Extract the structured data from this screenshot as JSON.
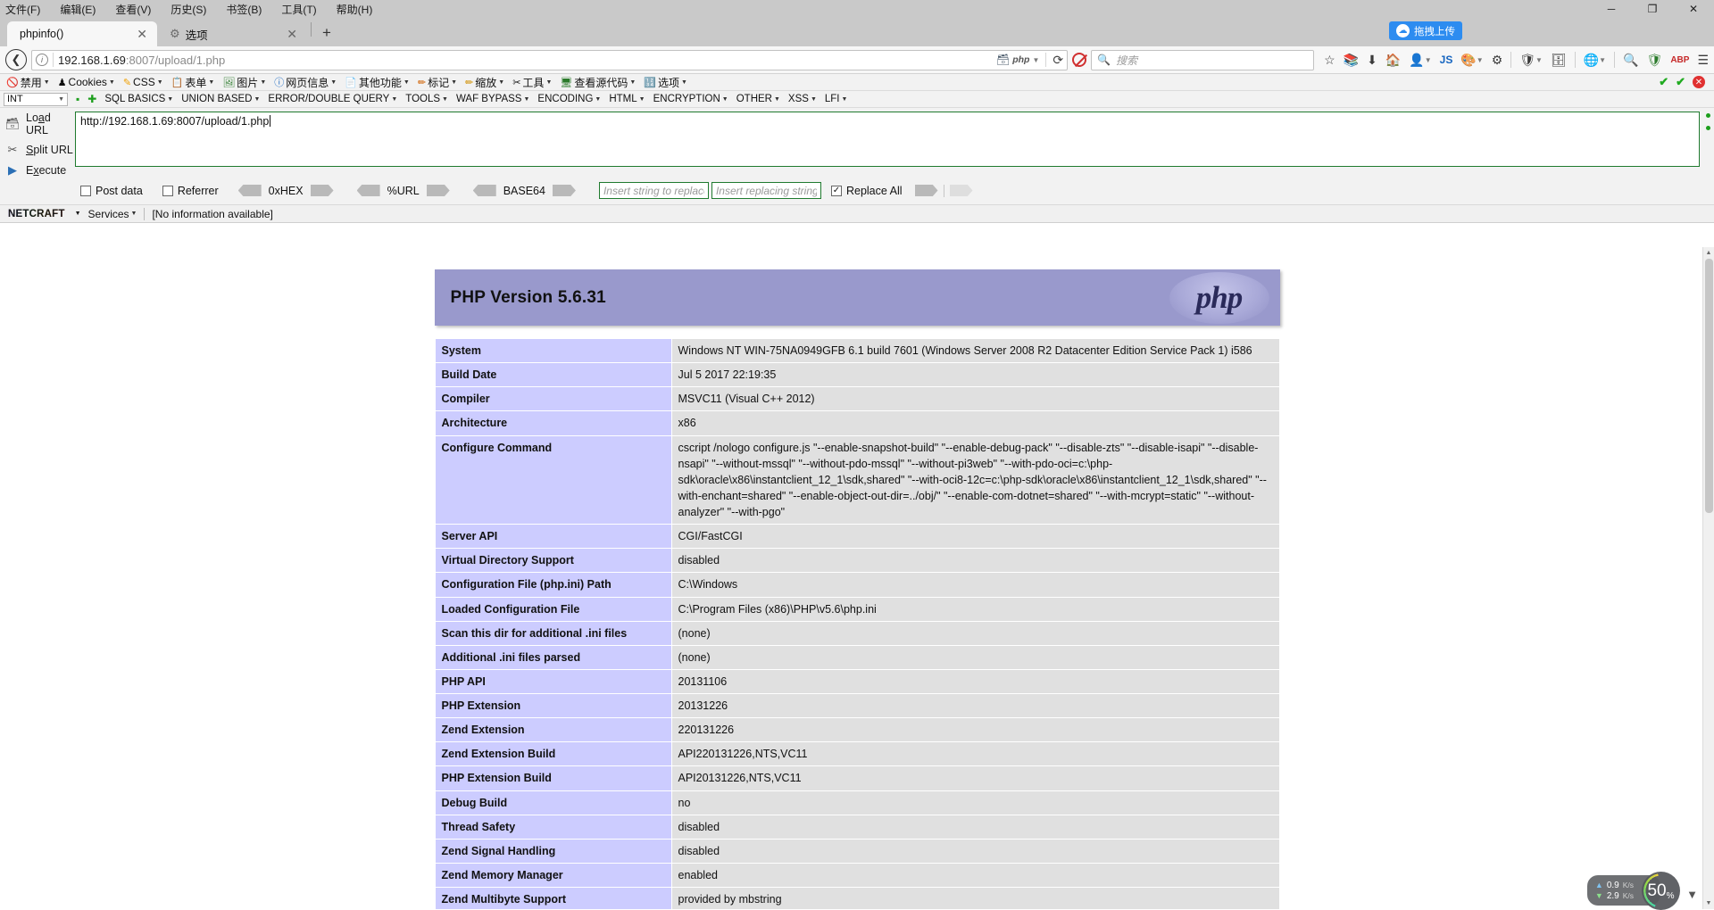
{
  "window": {
    "menu": [
      "文件(F)",
      "编辑(E)",
      "查看(V)",
      "历史(S)",
      "书签(B)",
      "工具(T)",
      "帮助(H)"
    ],
    "buttons": {
      "minimize": "─",
      "maximize": "❐",
      "close": "✕"
    }
  },
  "tabs": {
    "items": [
      {
        "label": "phpinfo()",
        "close": "✕",
        "icon": ""
      },
      {
        "label": "选项",
        "close": "✕",
        "icon": "gear-icon"
      }
    ],
    "new_tab": "+",
    "upload_pill": {
      "label": "拖拽上传",
      "icon": "cloud-upload-icon"
    }
  },
  "nav": {
    "back": "❮",
    "url": {
      "host": "192.168.1.69",
      "rest": ":8007/upload/1.php"
    },
    "php_badge": "php",
    "reload": "⟳",
    "search_placeholder": "搜索",
    "icons": [
      "star-icon",
      "library-icon",
      "download-icon",
      "home-icon",
      "account-icon",
      "js-icon",
      "palette-icon",
      "settings-icon",
      "shield-icon",
      "window-icon",
      "globe-icon",
      "cookie-icon",
      "zoom-icon",
      "adblock-icon",
      "abp-icon",
      "menu-icon"
    ],
    "js_label": "JS",
    "abp_label": "ABP"
  },
  "devtoolbar": {
    "items": [
      {
        "label": "禁用",
        "icon": "disable-icon"
      },
      {
        "label": "Cookies",
        "icon": "cookies-icon"
      },
      {
        "label": "CSS",
        "icon": "css-icon"
      },
      {
        "label": "表单",
        "icon": "forms-icon"
      },
      {
        "label": "图片",
        "icon": "images-icon"
      },
      {
        "label": "网页信息",
        "icon": "information-icon"
      },
      {
        "label": "其他功能",
        "icon": "misc-icon"
      },
      {
        "label": "标记",
        "icon": "outline-icon"
      },
      {
        "label": "缩放",
        "icon": "resize-icon"
      },
      {
        "label": "工具",
        "icon": "tools-icon"
      },
      {
        "label": "查看源代码",
        "icon": "viewsource-icon"
      },
      {
        "label": "选项",
        "icon": "options-icon"
      }
    ],
    "right_marks": [
      "✔",
      "✔",
      "✕"
    ]
  },
  "hackbar": {
    "sql_select": "INT",
    "sql_menus": [
      "SQL BASICS",
      "UNION BASED",
      "ERROR/DOUBLE QUERY",
      "TOOLS",
      "WAF BYPASS",
      "ENCODING",
      "HTML",
      "ENCRYPTION",
      "OTHER",
      "XSS",
      "LFI"
    ],
    "actions": [
      {
        "label_pre": "Lo",
        "label_key": "a",
        "label_post": "d URL",
        "icon": "load-url-icon"
      },
      {
        "label_pre": "",
        "label_key": "S",
        "label_post": "plit URL",
        "icon": "split-url-icon"
      },
      {
        "label_pre": "E",
        "label_key": "x",
        "label_post": "ecute",
        "icon": "execute-icon"
      }
    ],
    "url_value": "http://192.168.1.69:8007/upload/1.php",
    "options": {
      "post_data": {
        "label": "Post data",
        "checked": false
      },
      "referrer": {
        "label": "Referrer",
        "checked": false
      },
      "encoders": [
        "0xHEX",
        "%URL",
        "BASE64"
      ],
      "replace_from_placeholder": "Insert string to replace",
      "replace_to_placeholder": "Insert replacing string",
      "replace_all": {
        "label": "Replace All",
        "checked": true
      }
    }
  },
  "netcraft": {
    "logo": "ETCRAFT",
    "logo_first": "N",
    "services": "Services",
    "info": "[No information available]"
  },
  "phpinfo": {
    "title": "PHP Version 5.6.31",
    "logo_text": "php",
    "rows": [
      [
        "System",
        "Windows NT WIN-75NA0949GFB 6.1 build 7601 (Windows Server 2008 R2 Datacenter Edition Service Pack 1) i586"
      ],
      [
        "Build Date",
        "Jul 5 2017 22:19:35"
      ],
      [
        "Compiler",
        "MSVC11 (Visual C++ 2012)"
      ],
      [
        "Architecture",
        "x86"
      ],
      [
        "Configure Command",
        "cscript /nologo configure.js \"--enable-snapshot-build\" \"--enable-debug-pack\" \"--disable-zts\" \"--disable-isapi\" \"--disable-nsapi\" \"--without-mssql\" \"--without-pdo-mssql\" \"--without-pi3web\" \"--with-pdo-oci=c:\\php-sdk\\oracle\\x86\\instantclient_12_1\\sdk,shared\" \"--with-oci8-12c=c:\\php-sdk\\oracle\\x86\\instantclient_12_1\\sdk,shared\" \"--with-enchant=shared\" \"--enable-object-out-dir=../obj/\" \"--enable-com-dotnet=shared\" \"--with-mcrypt=static\" \"--without-analyzer\" \"--with-pgo\""
      ],
      [
        "Server API",
        "CGI/FastCGI"
      ],
      [
        "Virtual Directory Support",
        "disabled"
      ],
      [
        "Configuration File (php.ini) Path",
        "C:\\Windows"
      ],
      [
        "Loaded Configuration File",
        "C:\\Program Files (x86)\\PHP\\v5.6\\php.ini"
      ],
      [
        "Scan this dir for additional .ini files",
        "(none)"
      ],
      [
        "Additional .ini files parsed",
        "(none)"
      ],
      [
        "PHP API",
        "20131106"
      ],
      [
        "PHP Extension",
        "20131226"
      ],
      [
        "Zend Extension",
        "220131226"
      ],
      [
        "Zend Extension Build",
        "API220131226,NTS,VC11"
      ],
      [
        "PHP Extension Build",
        "API20131226,NTS,VC11"
      ],
      [
        "Debug Build",
        "no"
      ],
      [
        "Thread Safety",
        "disabled"
      ],
      [
        "Zend Signal Handling",
        "disabled"
      ],
      [
        "Zend Memory Manager",
        "enabled"
      ],
      [
        "Zend Multibyte Support",
        "provided by mbstring"
      ]
    ]
  },
  "status_overlay": {
    "upload_speed": "0.9",
    "upload_unit": "K/s",
    "download_speed": "2.9",
    "download_unit": "K/s",
    "cpu_value": "50",
    "cpu_unit": "%"
  },
  "colors": {
    "php_header": "#9999cc",
    "php_key_cell": "#ccccff",
    "php_value_cell": "#e0e0e0",
    "accent_blue": "#2d8cf0",
    "hackbar_border": "#1f7a2e"
  }
}
